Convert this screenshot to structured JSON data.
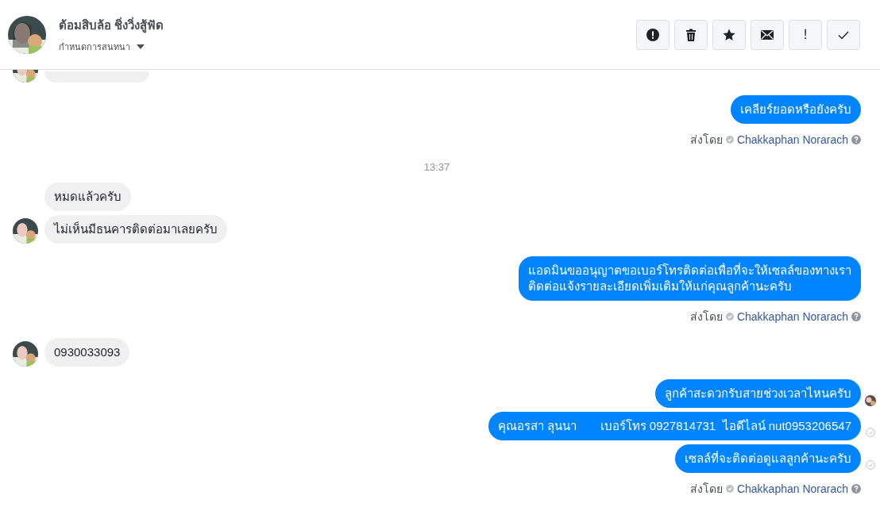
{
  "header": {
    "name": "ต้อมสิบล้อ ชิ่งวิ่งสู้ฟัด",
    "subtitle": "กำหนดการสนทนา",
    "toolbar": [
      {
        "kind": "report"
      },
      {
        "kind": "delete"
      },
      {
        "kind": "star"
      },
      {
        "kind": "mail"
      },
      {
        "kind": "text",
        "label": "!"
      },
      {
        "kind": "done"
      }
    ]
  },
  "messages": [
    {
      "kind": "incoming",
      "partial": true,
      "avatar": true
    },
    {
      "kind": "outgoing",
      "lines": [
        "เคลียร์ยอดหรือยังครับ"
      ],
      "seen": false,
      "delivered": false
    },
    {
      "kind": "sent_by",
      "label": "ส่งโดย",
      "name": "Chakkaphan Norarach"
    },
    {
      "kind": "time",
      "text": "13:37"
    },
    {
      "kind": "incoming",
      "lines": [
        "หมดแล้วครับ"
      ],
      "avatar": false
    },
    {
      "kind": "incoming",
      "lines": [
        "ไม่เห็นมีธนคารติดต่อมาเลยครับ"
      ],
      "avatar": true
    },
    {
      "kind": "outgoing",
      "lines": [
        "แอดมินขออนุญาตขอเบอร์โทรติดต่อเพื่อที่จะให้เซลล์ของทางเรา",
        "ติดต่อแจ้งรายละเอียดเพิ่มเติมให้แก่คุณลูกค้านะครับ"
      ],
      "seen": false,
      "delivered": false
    },
    {
      "kind": "sent_by",
      "label": "ส่งโดย",
      "name": "Chakkaphan Norarach"
    },
    {
      "kind": "incoming",
      "lines": [
        "0930033093"
      ],
      "avatar": true
    },
    {
      "kind": "outgoing",
      "lines": [
        "ลูกค้าสะดวกรับสายช่วงเวลาไหนครับ"
      ],
      "seen": true,
      "delivered": false
    },
    {
      "kind": "outgoing",
      "lines": [
        "คุณอรสา ลุนนา       เบอร์โทร 0927814731  ไอดีไลน์ nut0953206547"
      ],
      "seen": false,
      "delivered": true
    },
    {
      "kind": "outgoing",
      "lines": [
        "เซลล์ที่จะติดต่อดูแลลูกค้านะครับ"
      ],
      "seen": false,
      "delivered": true
    },
    {
      "kind": "sent_by",
      "label": "ส่งโดย",
      "name": "Chakkaphan Norarach"
    }
  ]
}
